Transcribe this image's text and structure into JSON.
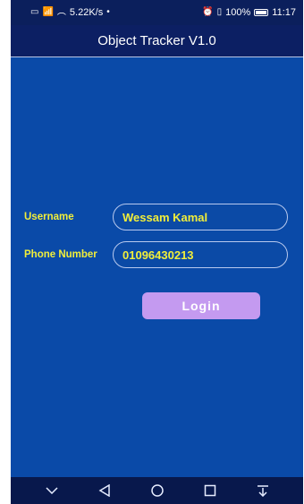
{
  "status_bar": {
    "left_text": "5.22K/s",
    "right_text": "100%",
    "time": "11:17"
  },
  "app_bar": {
    "title": "Object Tracker V1.0"
  },
  "form": {
    "username_label": "Username",
    "username_value": "Wessam Kamal",
    "phone_label": "Phone Number",
    "phone_value": "01096430213",
    "login_label": "Login"
  },
  "colors": {
    "background": "#0a4aa8",
    "app_bar": "#0c1f63",
    "label_yellow": "#f1ee3a",
    "button_purple": "#c49af0",
    "nav_bar": "#08184c"
  },
  "icons": {
    "nav_items": [
      "chevron-down-icon",
      "back-icon",
      "home-icon",
      "recents-icon",
      "notification-pull-icon"
    ]
  }
}
